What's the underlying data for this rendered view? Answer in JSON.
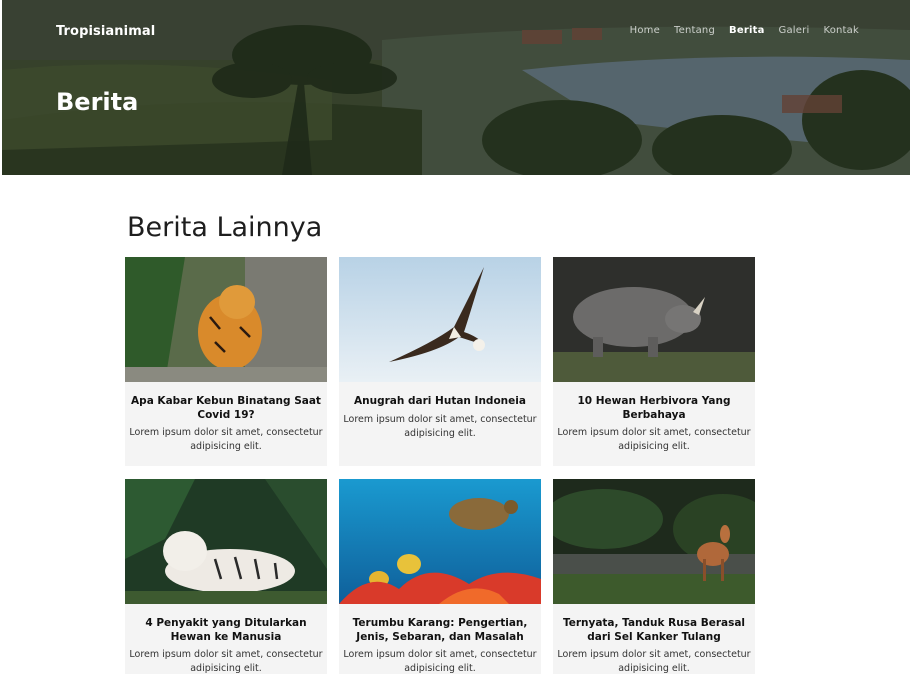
{
  "brand": "Tropisianimal",
  "nav": {
    "items": [
      {
        "label": "Home",
        "active": false
      },
      {
        "label": "Tentang",
        "active": false
      },
      {
        "label": "Berita",
        "active": true
      },
      {
        "label": "Galeri",
        "active": false
      },
      {
        "label": "Kontak",
        "active": false
      }
    ]
  },
  "hero": {
    "title": "Berita"
  },
  "section": {
    "title": "Berita Lainnya"
  },
  "cards": [
    {
      "title": "Apa Kabar Kebun Binatang Saat Covid 19?",
      "excerpt": "Lorem ipsum dolor sit amet, consectetur adipisicing elit.",
      "image": "tiger-photo"
    },
    {
      "title": "Anugrah dari Hutan Indoneia",
      "excerpt": "Lorem ipsum dolor sit amet, consectetur adipisicing elit.",
      "image": "eagle-photo"
    },
    {
      "title": "10 Hewan Herbivora Yang Berbahaya",
      "excerpt": "Lorem ipsum dolor sit amet, consectetur adipisicing elit.",
      "image": "rhino-photo"
    },
    {
      "title": "4 Penyakit yang Ditularkan Hewan ke Manusia",
      "excerpt": "Lorem ipsum dolor sit amet, consectetur adipisicing elit.",
      "image": "white-tiger-photo"
    },
    {
      "title": "Terumbu Karang: Pengertian, Jenis, Sebaran, dan Masalah",
      "excerpt": "Lorem ipsum dolor sit amet, consectetur adipisicing elit.",
      "image": "coral-reef-photo"
    },
    {
      "title": "Ternyata, Tanduk Rusa Berasal dari Sel Kanker Tulang",
      "excerpt": "Lorem ipsum dolor sit amet, consectetur adipisicing elit.",
      "image": "deer-photo"
    }
  ]
}
